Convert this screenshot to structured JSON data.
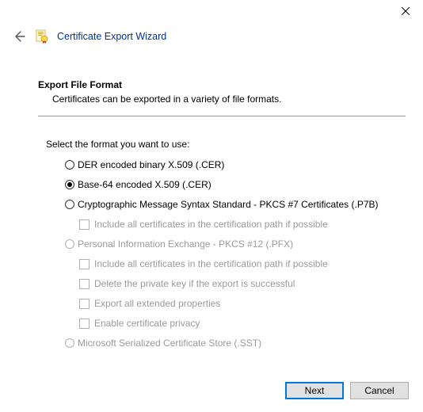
{
  "window": {
    "title": "Certificate Export Wizard"
  },
  "page": {
    "heading": "Export File Format",
    "description": "Certificates can be exported in a variety of file formats.",
    "prompt": "Select the format you want to use:"
  },
  "options": {
    "der": {
      "label": "DER encoded binary X.509 (.CER)",
      "enabled": true,
      "selected": false
    },
    "base64": {
      "label": "Base-64 encoded X.509 (.CER)",
      "enabled": true,
      "selected": true
    },
    "pkcs7": {
      "label": "Cryptographic Message Syntax Standard - PKCS #7 Certificates (.P7B)",
      "enabled": true,
      "selected": false,
      "include_chain": {
        "label": "Include all certificates in the certification path if possible",
        "enabled": false
      }
    },
    "pfx": {
      "label": "Personal Information Exchange - PKCS #12 (.PFX)",
      "enabled": false,
      "selected": false,
      "include_chain": {
        "label": "Include all certificates in the certification path if possible",
        "enabled": false
      },
      "delete_key": {
        "label": "Delete the private key if the export is successful",
        "enabled": false
      },
      "export_ext": {
        "label": "Export all extended properties",
        "enabled": false
      },
      "cert_privacy": {
        "label": "Enable certificate privacy",
        "enabled": false
      }
    },
    "sst": {
      "label": "Microsoft Serialized Certificate Store (.SST)",
      "enabled": false,
      "selected": false
    }
  },
  "buttons": {
    "next": "Next",
    "cancel": "Cancel"
  }
}
